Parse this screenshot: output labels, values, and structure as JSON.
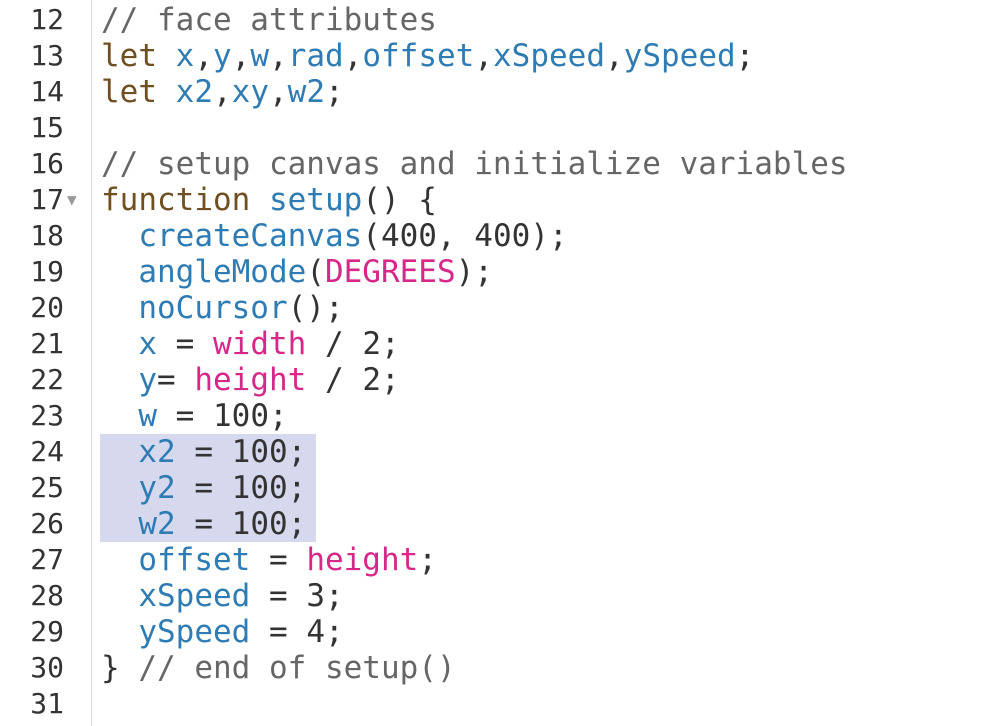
{
  "editor": {
    "lines": [
      {
        "num": "12",
        "tokens": [
          {
            "t": "// face attributes",
            "k": "comment"
          }
        ]
      },
      {
        "num": "13",
        "tokens": [
          {
            "t": "let ",
            "k": "keyword"
          },
          {
            "t": "x",
            "k": "var"
          },
          {
            "t": ",",
            "k": "punc"
          },
          {
            "t": "y",
            "k": "var"
          },
          {
            "t": ",",
            "k": "punc"
          },
          {
            "t": "w",
            "k": "var"
          },
          {
            "t": ",",
            "k": "punc"
          },
          {
            "t": "rad",
            "k": "var"
          },
          {
            "t": ",",
            "k": "punc"
          },
          {
            "t": "offset",
            "k": "var"
          },
          {
            "t": ",",
            "k": "punc"
          },
          {
            "t": "xSpeed",
            "k": "var"
          },
          {
            "t": ",",
            "k": "punc"
          },
          {
            "t": "ySpeed",
            "k": "var"
          },
          {
            "t": ";",
            "k": "punc"
          }
        ]
      },
      {
        "num": "14",
        "tokens": [
          {
            "t": "let ",
            "k": "keyword"
          },
          {
            "t": "x2",
            "k": "var"
          },
          {
            "t": ",",
            "k": "punc"
          },
          {
            "t": "xy",
            "k": "var"
          },
          {
            "t": ",",
            "k": "punc"
          },
          {
            "t": "w2",
            "k": "var"
          },
          {
            "t": ";",
            "k": "punc"
          }
        ]
      },
      {
        "num": "15",
        "tokens": []
      },
      {
        "num": "16",
        "tokens": [
          {
            "t": "// setup canvas and initialize variables",
            "k": "comment"
          }
        ]
      },
      {
        "num": "17",
        "fold": "▼",
        "tokens": [
          {
            "t": "function ",
            "k": "keyword"
          },
          {
            "t": "setup",
            "k": "def"
          },
          {
            "t": "() {",
            "k": "punc"
          }
        ]
      },
      {
        "num": "18",
        "tokens": [
          {
            "t": "  ",
            "k": "punc"
          },
          {
            "t": "createCanvas",
            "k": "builtin"
          },
          {
            "t": "(",
            "k": "punc"
          },
          {
            "t": "400",
            "k": "num"
          },
          {
            "t": ", ",
            "k": "punc"
          },
          {
            "t": "400",
            "k": "num"
          },
          {
            "t": ");",
            "k": "punc"
          }
        ]
      },
      {
        "num": "19",
        "tokens": [
          {
            "t": "  ",
            "k": "punc"
          },
          {
            "t": "angleMode",
            "k": "builtin"
          },
          {
            "t": "(",
            "k": "punc"
          },
          {
            "t": "DEGREES",
            "k": "const"
          },
          {
            "t": ");",
            "k": "punc"
          }
        ]
      },
      {
        "num": "20",
        "tokens": [
          {
            "t": "  ",
            "k": "punc"
          },
          {
            "t": "noCursor",
            "k": "builtin"
          },
          {
            "t": "();",
            "k": "punc"
          }
        ]
      },
      {
        "num": "21",
        "tokens": [
          {
            "t": "  ",
            "k": "punc"
          },
          {
            "t": "x",
            "k": "var"
          },
          {
            "t": " = ",
            "k": "op"
          },
          {
            "t": "width",
            "k": "const"
          },
          {
            "t": " / ",
            "k": "op"
          },
          {
            "t": "2",
            "k": "num"
          },
          {
            "t": ";",
            "k": "punc"
          }
        ]
      },
      {
        "num": "22",
        "tokens": [
          {
            "t": "  ",
            "k": "punc"
          },
          {
            "t": "y",
            "k": "var"
          },
          {
            "t": "= ",
            "k": "op"
          },
          {
            "t": "height",
            "k": "const"
          },
          {
            "t": " / ",
            "k": "op"
          },
          {
            "t": "2",
            "k": "num"
          },
          {
            "t": ";",
            "k": "punc"
          }
        ]
      },
      {
        "num": "23",
        "tokens": [
          {
            "t": "  ",
            "k": "punc"
          },
          {
            "t": "w",
            "k": "var"
          },
          {
            "t": " = ",
            "k": "op"
          },
          {
            "t": "100",
            "k": "num"
          },
          {
            "t": ";",
            "k": "punc"
          }
        ]
      },
      {
        "num": "24",
        "tokens": [
          {
            "t": "  ",
            "k": "punc"
          },
          {
            "t": "x2",
            "k": "var"
          },
          {
            "t": " = ",
            "k": "op"
          },
          {
            "t": "100",
            "k": "num"
          },
          {
            "t": ";",
            "k": "punc"
          }
        ]
      },
      {
        "num": "25",
        "tokens": [
          {
            "t": "  ",
            "k": "punc"
          },
          {
            "t": "y2",
            "k": "var"
          },
          {
            "t": " = ",
            "k": "op"
          },
          {
            "t": "100",
            "k": "num"
          },
          {
            "t": ";",
            "k": "punc"
          }
        ]
      },
      {
        "num": "26",
        "tokens": [
          {
            "t": "  ",
            "k": "punc"
          },
          {
            "t": "w2",
            "k": "var"
          },
          {
            "t": " = ",
            "k": "op"
          },
          {
            "t": "100",
            "k": "num"
          },
          {
            "t": ";",
            "k": "punc"
          }
        ]
      },
      {
        "num": "27",
        "tokens": [
          {
            "t": "  ",
            "k": "punc"
          },
          {
            "t": "offset",
            "k": "var"
          },
          {
            "t": " = ",
            "k": "op"
          },
          {
            "t": "height",
            "k": "const"
          },
          {
            "t": ";",
            "k": "punc"
          }
        ]
      },
      {
        "num": "28",
        "tokens": [
          {
            "t": "  ",
            "k": "punc"
          },
          {
            "t": "xSpeed",
            "k": "var"
          },
          {
            "t": " = ",
            "k": "op"
          },
          {
            "t": "3",
            "k": "num"
          },
          {
            "t": ";",
            "k": "punc"
          }
        ]
      },
      {
        "num": "29",
        "tokens": [
          {
            "t": "  ",
            "k": "punc"
          },
          {
            "t": "ySpeed",
            "k": "var"
          },
          {
            "t": " = ",
            "k": "op"
          },
          {
            "t": "4",
            "k": "num"
          },
          {
            "t": ";",
            "k": "punc"
          }
        ]
      },
      {
        "num": "30",
        "tokens": [
          {
            "t": "} ",
            "k": "punc"
          },
          {
            "t": "// end of setup()",
            "k": "comment"
          }
        ]
      },
      {
        "num": "31",
        "tokens": []
      }
    ]
  },
  "colors": {
    "comment": "#666666",
    "keyword": "#704f21",
    "identifier": "#2e7cb3",
    "constant": "#d52889",
    "text": "#333333",
    "selection": "#d6d8ee"
  },
  "icons": {
    "fold": "fold-arrow-icon"
  }
}
